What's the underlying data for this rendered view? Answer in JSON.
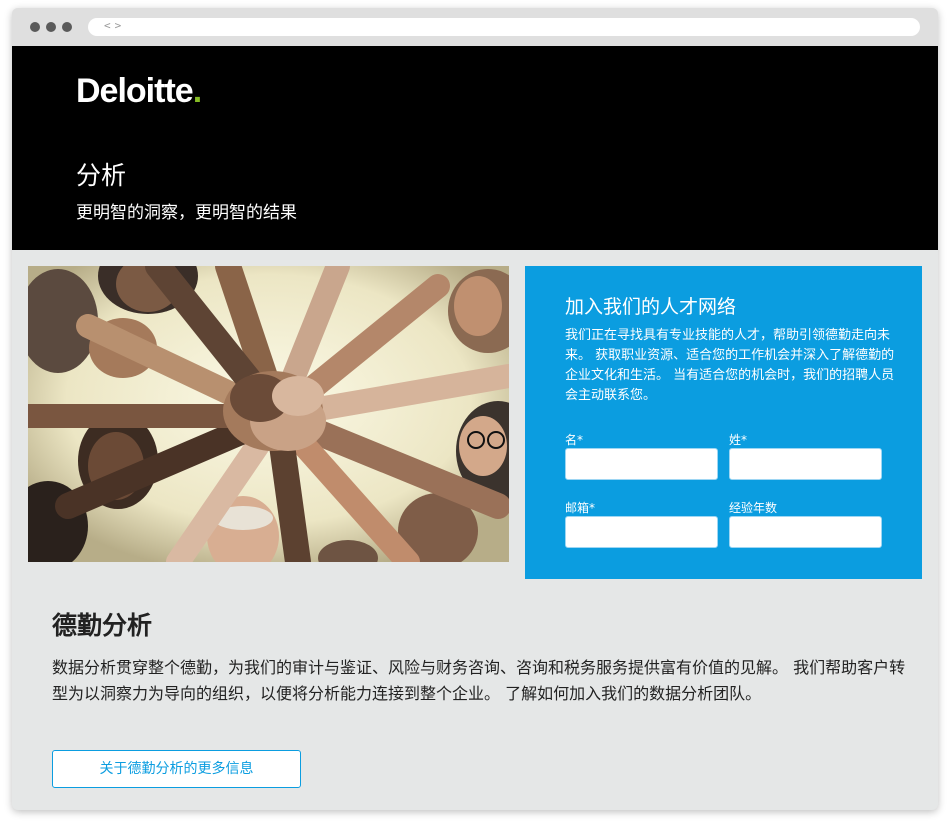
{
  "browser": {
    "nav_arrows": "<>"
  },
  "header": {
    "logo": "Deloitte",
    "logo_dot": ".",
    "title": "分析",
    "subtitle": "更明智的洞察，更明智的结果"
  },
  "talent_form": {
    "title": "加入我们的人才网络",
    "description": "我们正在寻找具有专业技能的人才，帮助引领德勤走向未来。 获取职业资源、适合您的工作机会并深入了解德勤的企业文化和生活。 当有适合您的机会时，我们的招聘人员会主动联系您。",
    "fields": {
      "first_name": {
        "label": "名*",
        "value": ""
      },
      "last_name": {
        "label": "姓*",
        "value": ""
      },
      "email": {
        "label": "邮箱*",
        "value": ""
      },
      "experience": {
        "label": "经验年数",
        "value": ""
      }
    }
  },
  "main": {
    "section_title": "德勤分析",
    "section_body": "数据分析贯穿整个德勤，为我们的审计与鉴证、风险与财务咨询、咨询和税务服务提供富有价值的见解。 我们帮助客户转型为以洞察力为导向的组织，以便将分析能力连接到整个企业。 了解如何加入我们的数据分析团队。",
    "more_button": "关于德勤分析的更多信息"
  },
  "colors": {
    "brand_green": "#86bc25",
    "accent_blue": "#0b9de0",
    "hero_bg": "#000000",
    "page_bg": "#e5e7e7"
  }
}
